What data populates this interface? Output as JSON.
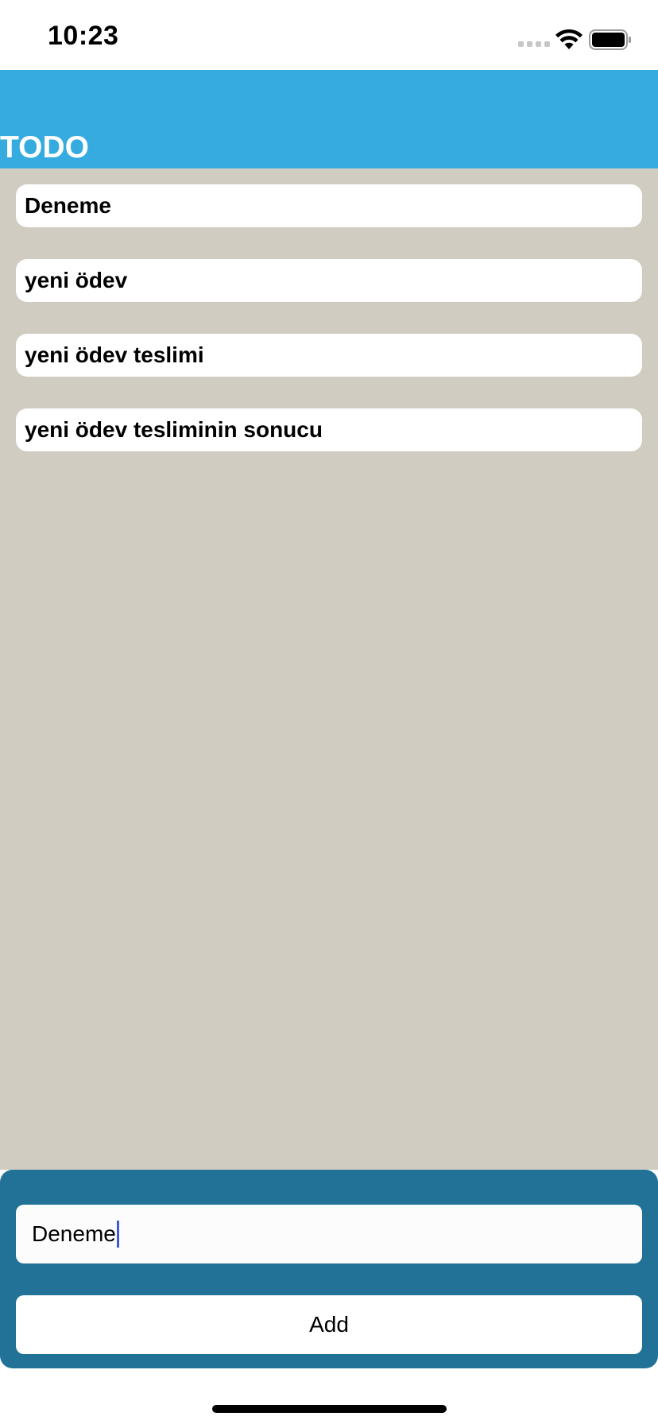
{
  "status_bar": {
    "time": "10:23",
    "icons": [
      "cellular-signal-icon",
      "wifi-icon",
      "battery-icon"
    ]
  },
  "header": {
    "title": "TODO",
    "background_color": "#35abdf",
    "title_color": "#ffffff"
  },
  "todos": [
    {
      "text": "Deneme"
    },
    {
      "text": "yeni ödev"
    },
    {
      "text": "yeni ödev teslimi"
    },
    {
      "text": "yeni ödev tesliminin sonucu"
    }
  ],
  "content_background_color": "#d1ccc1",
  "composer": {
    "background_color": "#227196",
    "input_value": "Deneme",
    "add_label": "Add"
  }
}
